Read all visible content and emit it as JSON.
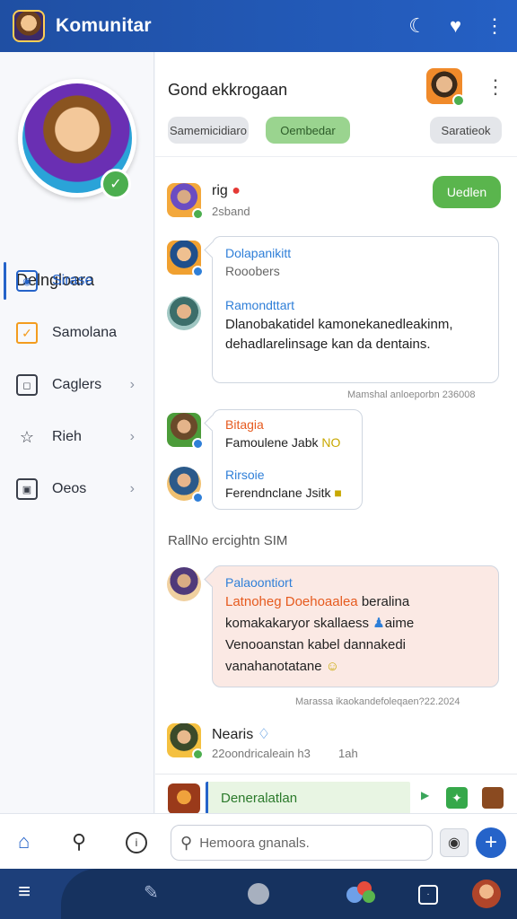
{
  "app": {
    "title": "Komunitar"
  },
  "sidebar": {
    "profile_name": "Delngloara",
    "items": [
      {
        "label": "Sirase",
        "icon": "camera-icon",
        "active": true
      },
      {
        "label": "Samolana",
        "icon": "note-icon",
        "active": false
      },
      {
        "label": "Caglers",
        "icon": "frame-icon",
        "active": false
      },
      {
        "label": "Rieh",
        "icon": "star-icon",
        "active": false
      },
      {
        "label": "Oeos",
        "icon": "gallery-icon",
        "active": false
      }
    ]
  },
  "main": {
    "title": "Gond ekkrogaan",
    "chips": [
      "Samemicidiaro",
      "Oembedar",
      "Saratieok"
    ],
    "top_message": {
      "name": "rig",
      "sub": "2sband",
      "reply_label": "Uedlen"
    },
    "thread1": {
      "line1_name": "Dolapanikitt",
      "line1_sub": "Rooobers",
      "line2_name": "Ramondttart",
      "line2_text_1": "Dlanobakatidel kamonekanedleakinm,",
      "line2_text_2": "dehadlarelinsage kan da dentains."
    },
    "stamp1": "Mamshal anloeporbn 236008",
    "thread2": {
      "line1_name": "Bitagia",
      "line1_text": "Famoulene Jabk",
      "line1_tag": "NO",
      "line2_name": "Rirsoie",
      "line2_text": "Ferendnclane Jsitk"
    },
    "day_label": "Ra⁠llNo ercightn SIM",
    "thread3": {
      "name": "Palaoontiort",
      "line1_a": "Latnoheg Doehoaalea",
      "line1_b": "beralina",
      "line2": "komakakaryor skallaess",
      "line2_b": "aime",
      "line3": "Venooanstan kabel dannakedi",
      "line4": "vanahanotatane"
    },
    "stamp2": "Marassa ikaokandefoleqaen?22.2024",
    "last_message": {
      "name": "Nearis",
      "sub": "22oondricaleain h3",
      "time": "1ah"
    },
    "compose_label": "Deneralatlan"
  },
  "input_bar": {
    "placeholder": "Hemoora gnanals."
  }
}
